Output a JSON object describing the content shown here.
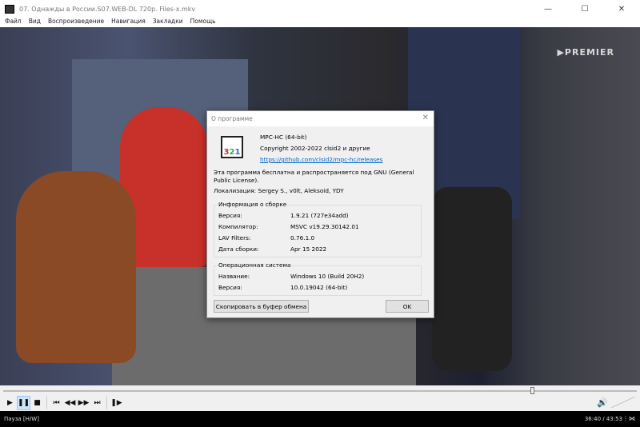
{
  "window": {
    "title": "07. Однажды в России.S07.WEB-DL 720p. Files-x.mkv",
    "minimize": "—",
    "maximize": "☐",
    "close": "✕"
  },
  "menu": [
    "Файл",
    "Вид",
    "Воспроизведение",
    "Навигация",
    "Закладки",
    "Помощь"
  ],
  "video": {
    "watermark": "▶PREMIER"
  },
  "dialog": {
    "title": "О программе",
    "close": "✕",
    "logo_text": [
      "3",
      "2",
      "1"
    ],
    "product": "MPC-HC (64-bit)",
    "copyright": "Copyright 2002-2022 clsid2 и другие",
    "link": "https://github.com/clsid2/mpc-hc/releases",
    "license": "Эта программа бесплатна и распространяется под GNU (General Public License).",
    "localization": "Локализация: Sergey S., v0lt, Aleksoid, YDY",
    "build_group": {
      "title": "Информация о сборке",
      "rows": [
        {
          "label": "Версия:",
          "value": "1.9.21 (727e34add)"
        },
        {
          "label": "Компилятор:",
          "value": "MSVC v19.29.30142.01"
        },
        {
          "label": "LAV Filters:",
          "value": "0.76.1.0"
        },
        {
          "label": "Дата сборки:",
          "value": "Apr 15 2022"
        }
      ]
    },
    "os_group": {
      "title": "Операционная система",
      "rows": [
        {
          "label": "Название:",
          "value": "Windows 10 (Build 20H2)"
        },
        {
          "label": "Версия:",
          "value": "10.0.19042 (64-bit)"
        }
      ]
    },
    "copy_button": "Скопировать в буфер обмена",
    "ok_button": "OK"
  },
  "player": {
    "seek_fraction": 0.835,
    "status": "Пауза [H/W]",
    "time": "36:40 / 43:53",
    "volume_icon": "🔊"
  },
  "colors": {
    "accent": "#0066cc",
    "active_button": "#cce4f7"
  }
}
